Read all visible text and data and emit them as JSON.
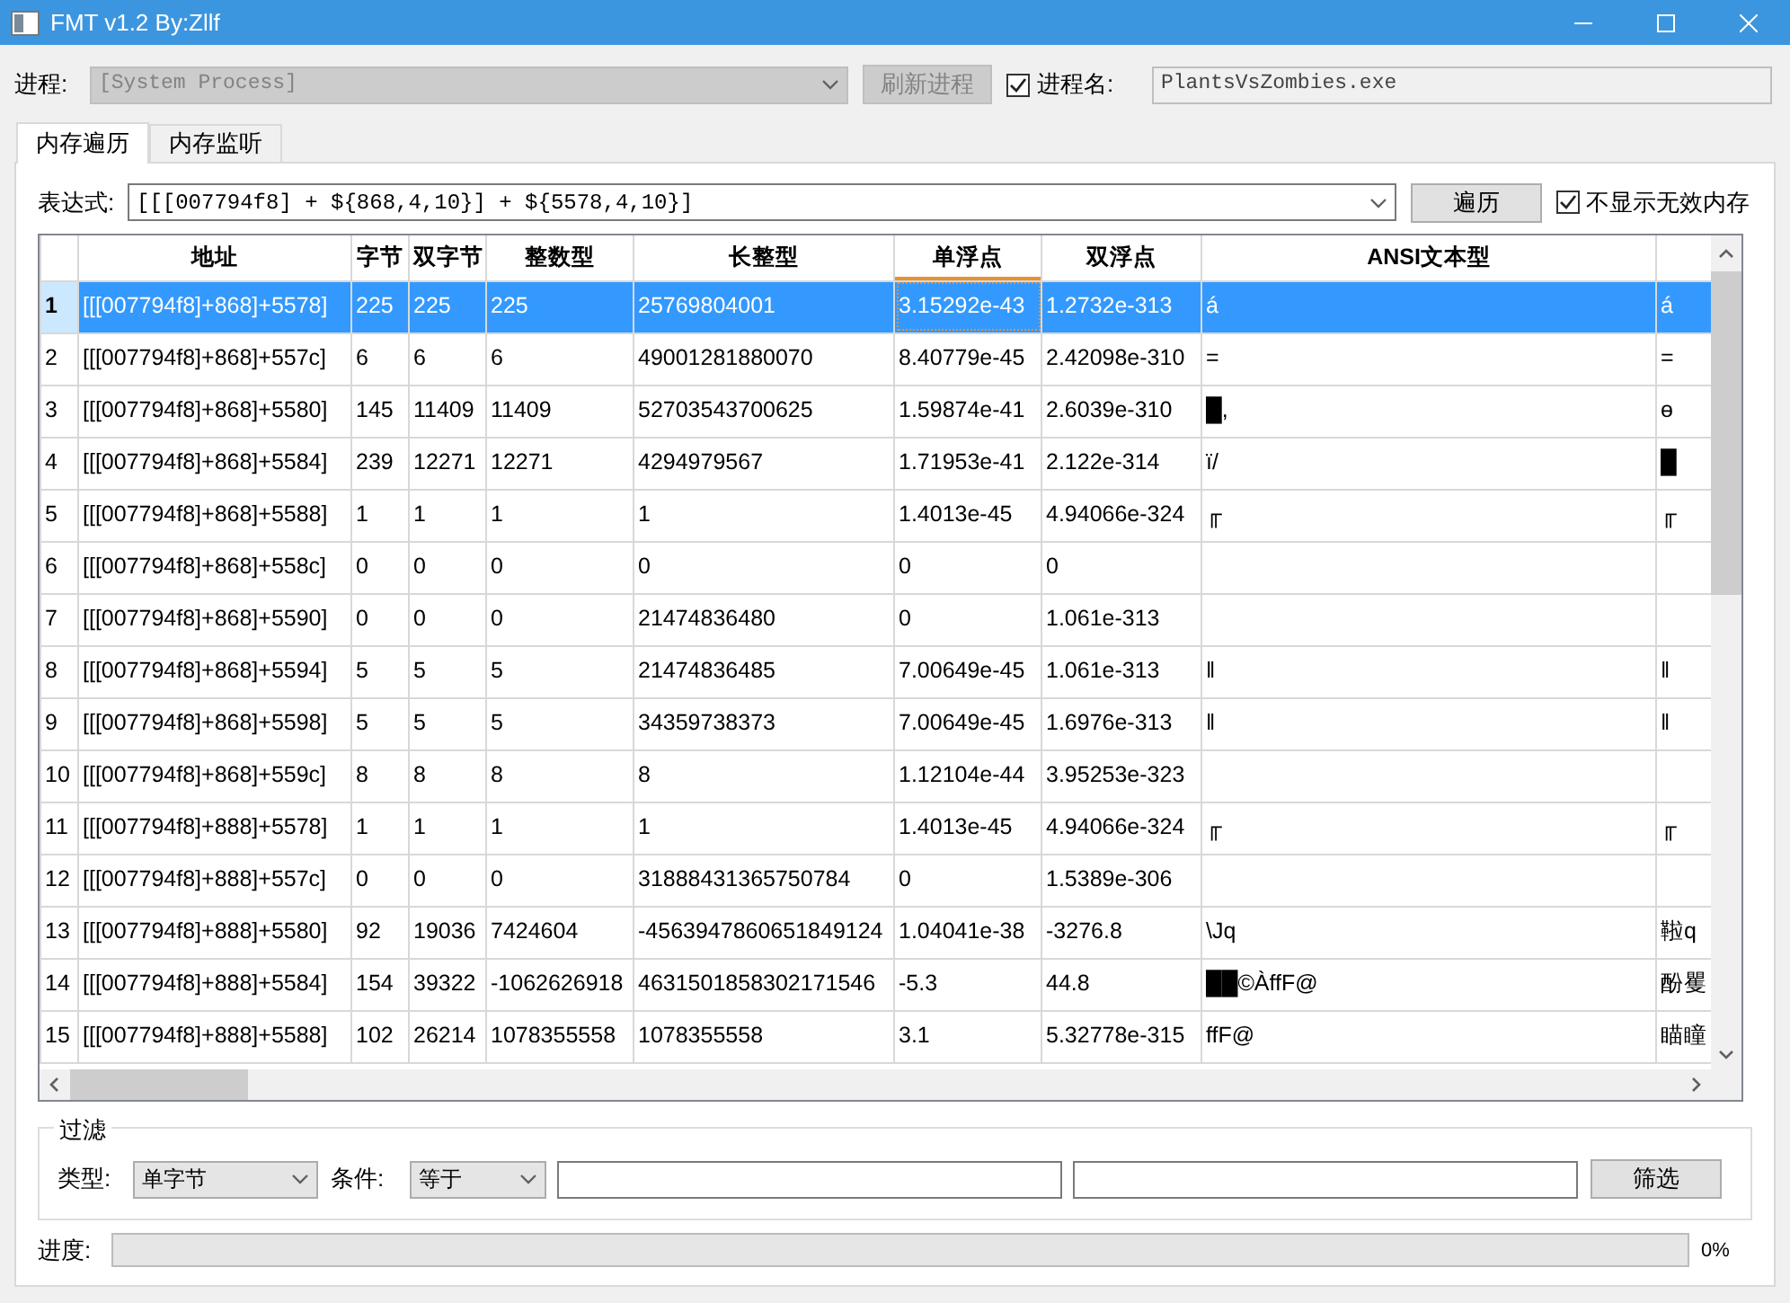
{
  "window": {
    "title": "FMT v1.2 By:Zllf"
  },
  "process": {
    "label": "进程:",
    "value": "[System Process]",
    "disabled": true
  },
  "refresh_button": {
    "label": "刷新进程",
    "disabled": true
  },
  "process_name": {
    "label": "进程名:",
    "checked": true,
    "value": "PlantsVsZombies.exe"
  },
  "tabs": [
    {
      "label": "内存遍历",
      "selected": true
    },
    {
      "label": "内存监听",
      "selected": false
    }
  ],
  "expression": {
    "label": "表达式:",
    "value": "[[[007794f8] + ${868,4,10}] + ${5578,4,10}]"
  },
  "traverse_button": {
    "label": "遍历"
  },
  "hide_invalid": {
    "label": "不显示无效内存",
    "checked": true
  },
  "table": {
    "columns": [
      {
        "label": "地址",
        "current": false
      },
      {
        "label": "字节",
        "current": false
      },
      {
        "label": "双字节",
        "current": false
      },
      {
        "label": "整数型",
        "current": false
      },
      {
        "label": "长整型",
        "current": false
      },
      {
        "label": "单浮点",
        "current": true
      },
      {
        "label": "双浮点",
        "current": false
      },
      {
        "label": "ANSI文本型",
        "current": false
      }
    ],
    "rows": [
      {
        "index": "1",
        "selected": true,
        "cells": [
          "[[[007794f8]+868]+5578]",
          "225",
          "225",
          "225",
          "25769804001",
          "3.15292e-43",
          "1.2732e-313",
          "á",
          "á"
        ]
      },
      {
        "index": "2",
        "selected": false,
        "cells": [
          "[[[007794f8]+868]+557c]",
          "6",
          "6",
          "6",
          "49001281880070",
          "8.40779e-45",
          "2.42098e-310",
          "=",
          "="
        ]
      },
      {
        "index": "3",
        "selected": false,
        "cells": [
          "[[[007794f8]+868]+5580]",
          "145",
          "11409",
          "11409",
          "52703543700625",
          "1.59874e-41",
          "2.6039e-310",
          "█,",
          "ɵ"
        ]
      },
      {
        "index": "4",
        "selected": false,
        "cells": [
          "[[[007794f8]+868]+5584]",
          "239",
          "12271",
          "12271",
          "4294979567",
          "1.71953e-41",
          "2.122e-314",
          "ï/",
          "█"
        ]
      },
      {
        "index": "5",
        "selected": false,
        "cells": [
          "[[[007794f8]+868]+5588]",
          "1",
          "1",
          "1",
          "1",
          "1.4013e-45",
          "4.94066e-324",
          "╓",
          "╓"
        ]
      },
      {
        "index": "6",
        "selected": false,
        "cells": [
          "[[[007794f8]+868]+558c]",
          "0",
          "0",
          "0",
          "0",
          "0",
          "0",
          null,
          null
        ]
      },
      {
        "index": "7",
        "selected": false,
        "cells": [
          "[[[007794f8]+868]+5590]",
          "0",
          "0",
          "0",
          "21474836480",
          "0",
          "1.061e-313",
          null,
          null
        ]
      },
      {
        "index": "8",
        "selected": false,
        "cells": [
          "[[[007794f8]+868]+5594]",
          "5",
          "5",
          "5",
          "21474836485",
          "7.00649e-45",
          "1.061e-313",
          "‖",
          "‖"
        ]
      },
      {
        "index": "9",
        "selected": false,
        "cells": [
          "[[[007794f8]+868]+5598]",
          "5",
          "5",
          "5",
          "34359738373",
          "7.00649e-45",
          "1.6976e-313",
          "‖",
          "‖"
        ]
      },
      {
        "index": "10",
        "selected": false,
        "cells": [
          "[[[007794f8]+868]+559c]",
          "8",
          "8",
          "8",
          "8",
          "1.12104e-44",
          "3.95253e-323",
          null,
          null
        ]
      },
      {
        "index": "11",
        "selected": false,
        "cells": [
          "[[[007794f8]+888]+5578]",
          "1",
          "1",
          "1",
          "1",
          "1.4013e-45",
          "4.94066e-324",
          "╓",
          "╓"
        ]
      },
      {
        "index": "12",
        "selected": false,
        "cells": [
          "[[[007794f8]+888]+557c]",
          "0",
          "0",
          "0",
          "31888431365750784",
          "0",
          "1.5389e-306",
          null,
          null
        ]
      },
      {
        "index": "13",
        "selected": false,
        "cells": [
          "[[[007794f8]+888]+5580]",
          "92",
          "19036",
          "7424604",
          "-4563947860651849124",
          "1.04041e-38",
          "-3276.8",
          "\\Jq",
          "鞡q"
        ]
      },
      {
        "index": "14",
        "selected": false,
        "cells": [
          "[[[007794f8]+888]+5584]",
          "154",
          "39322",
          "-1062626918",
          "4631501858302171546",
          "-5.3",
          "44.8",
          "██©ÀffF@",
          "酚矍"
        ]
      },
      {
        "index": "15",
        "selected": false,
        "cells": [
          "[[[007794f8]+888]+5588]",
          "102",
          "26214",
          "1078355558",
          "1078355558",
          "3.1",
          "5.32778e-315",
          "ffF@",
          "瞄瞳"
        ]
      }
    ]
  },
  "filter": {
    "title": "过滤",
    "type_label": "类型:",
    "type_value": "单字节",
    "condition_label": "条件:",
    "condition_value": "等于",
    "button": "筛选"
  },
  "progress": {
    "label": "进度:",
    "level": 0,
    "reading": "0%"
  }
}
